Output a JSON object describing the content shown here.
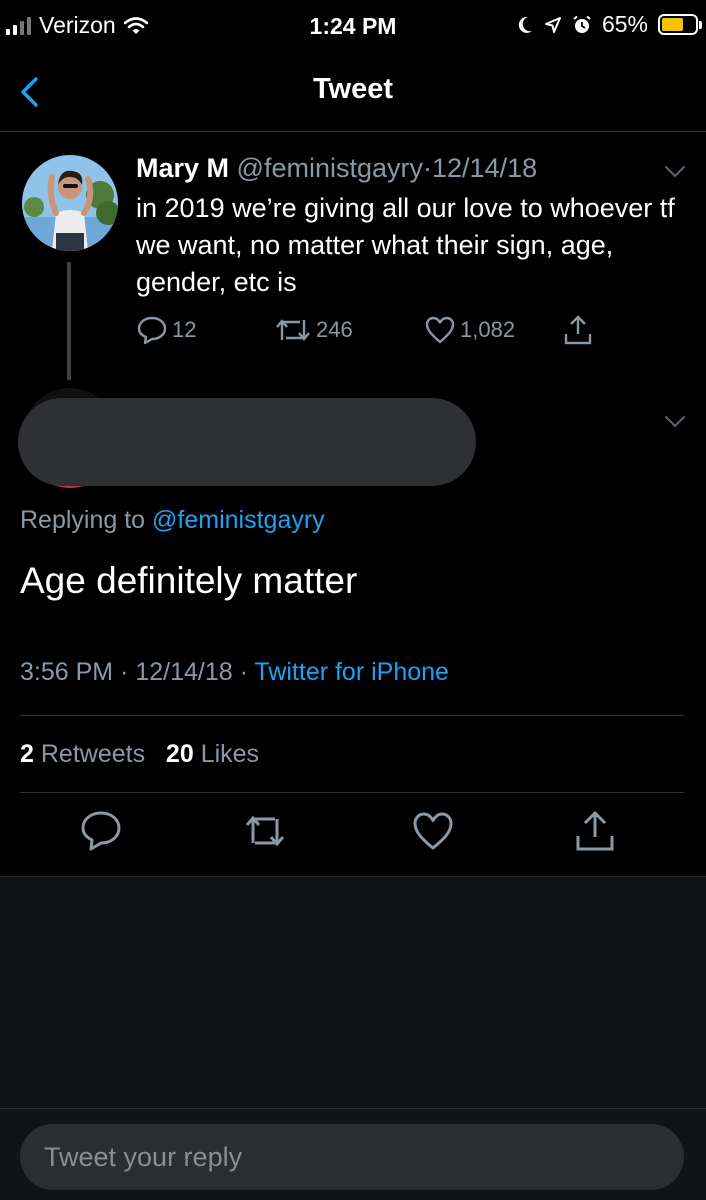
{
  "status_bar": {
    "carrier": "Verizon",
    "time": "1:24 PM",
    "battery": "65%",
    "battery_level": 0.65,
    "battery_color": "#f5c400",
    "icons": [
      "signal-icon",
      "wifi-icon",
      "moon-icon",
      "location-icon",
      "alarm-icon",
      "battery-icon"
    ]
  },
  "nav": {
    "title": "Tweet",
    "back_icon": "chevron-left-icon"
  },
  "original_tweet": {
    "name": "Mary M",
    "handle": "@feministgayry",
    "separator": "·",
    "date": "12/14/18",
    "text": "in 2019 we’re giving all our love to whoever tf we want, no matter what their sign, age, gender, etc is",
    "replies": "12",
    "retweets": "246",
    "likes": "1,082"
  },
  "reply": {
    "replying_prefix": "Replying to",
    "replying_handle": "@feministgayry",
    "text": "Age definitely matter",
    "time": "3:56 PM",
    "date": "12/14/18",
    "source": "Twitter for iPhone",
    "retweets_count": "2",
    "retweets_label": "Retweets",
    "likes_count": "20",
    "likes_label": "Likes"
  },
  "composer": {
    "placeholder": "Tweet your reply"
  },
  "colors": {
    "accent": "#1da1f2",
    "muted": "#8899a6",
    "background": "#000000"
  }
}
